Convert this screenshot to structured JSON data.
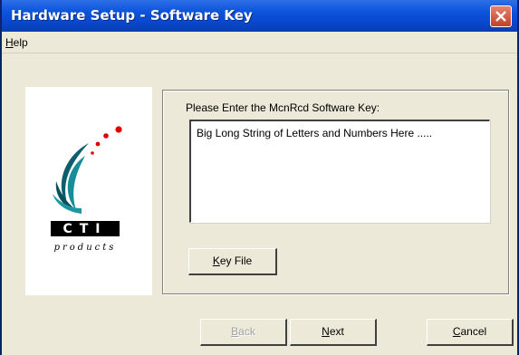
{
  "window": {
    "title": "Hardware Setup - Software Key"
  },
  "menu": {
    "help_label": "Help"
  },
  "logo": {
    "brand": "CTI",
    "tagline": "products"
  },
  "form": {
    "prompt": "Please Enter the McnRcd Software Key:",
    "key_value": "Big Long String of Letters and Numbers Here .....",
    "key_file_label": "Key File"
  },
  "footer": {
    "back_label": "Back",
    "next_label": "Next",
    "cancel_label": "Cancel"
  },
  "colors": {
    "title_bar": "#0846cc",
    "logo_teal": "#0b6f7a",
    "logo_red": "#e00000"
  }
}
